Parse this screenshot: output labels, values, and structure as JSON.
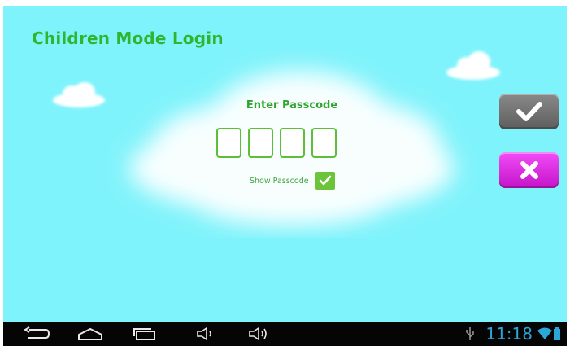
{
  "app": {
    "title": "Children Mode Login"
  },
  "passcode": {
    "label": "Enter Passcode",
    "digits": [
      "",
      "",
      "",
      ""
    ],
    "show_label": "Show Passcode",
    "show_checked": true
  },
  "actions": {
    "confirm_icon": "check-icon",
    "cancel_icon": "close-icon"
  },
  "status_bar": {
    "time": "11:18",
    "icons": [
      "back-icon",
      "home-icon",
      "recent-apps-icon",
      "volume-down-icon",
      "volume-up-icon",
      "usb-icon",
      "wifi-icon",
      "battery-icon"
    ]
  },
  "colors": {
    "background": "#7ff3fb",
    "title": "#2fb52f",
    "box_border": "#5bbf3a",
    "confirm_button": "#6f6f6f",
    "cancel_button": "#e022e6",
    "clock": "#2aa6d8"
  }
}
